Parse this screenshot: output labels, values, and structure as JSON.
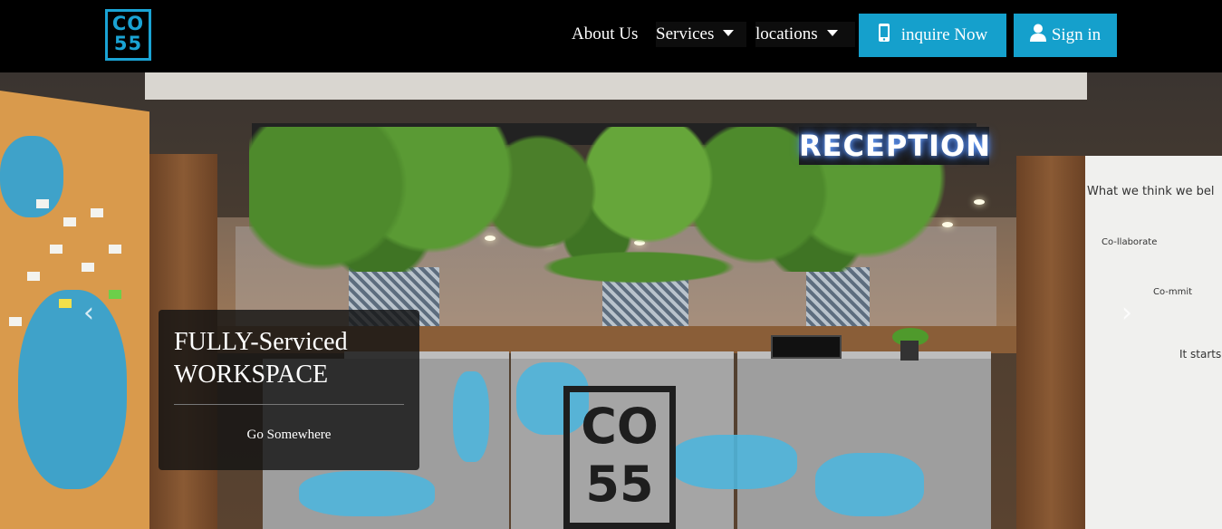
{
  "nav": {
    "logo_top": "CO",
    "logo_bottom": "55",
    "about": "About Us",
    "services": "Services",
    "locations": "locations",
    "inquire": "inquire Now",
    "signin": "Sign in"
  },
  "hero": {
    "sign": "RECEPTION",
    "desk_logo_top": "CO",
    "desk_logo_bottom": "55",
    "wall_heading": "What we think we bel",
    "wall_1": "Co-llaborate",
    "wall_2": "Co-mmit",
    "wall_3": "It starts"
  },
  "caption": {
    "title": "FULLY-Serviced WORKSPACE",
    "link": "Go Somewhere"
  },
  "carousel": {
    "prev": "‹",
    "next": "›"
  },
  "colors": {
    "accent": "#15a0cc",
    "logo": "#1aa3d4"
  }
}
